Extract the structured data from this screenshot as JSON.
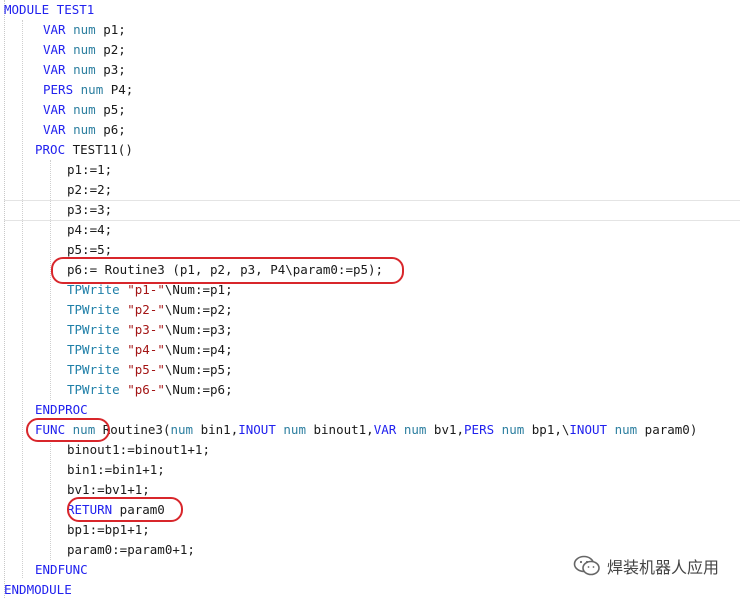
{
  "code": {
    "lines": [
      {
        "indent": 0,
        "tokens": [
          {
            "t": "MODULE TEST1",
            "c": "kw"
          }
        ]
      },
      {
        "indent": 3,
        "tokens": [
          {
            "t": "VAR",
            "c": "kw"
          },
          {
            "t": " "
          },
          {
            "t": "num",
            "c": "ty"
          },
          {
            "t": " p1;"
          }
        ]
      },
      {
        "indent": 3,
        "tokens": [
          {
            "t": "VAR",
            "c": "kw"
          },
          {
            "t": " "
          },
          {
            "t": "num",
            "c": "ty"
          },
          {
            "t": " p2;"
          }
        ]
      },
      {
        "indent": 3,
        "tokens": [
          {
            "t": "VAR",
            "c": "kw"
          },
          {
            "t": " "
          },
          {
            "t": "num",
            "c": "ty"
          },
          {
            "t": " p3;"
          }
        ]
      },
      {
        "indent": 3,
        "tokens": [
          {
            "t": "PERS",
            "c": "kw"
          },
          {
            "t": " "
          },
          {
            "t": "num",
            "c": "ty"
          },
          {
            "t": " P4;"
          }
        ]
      },
      {
        "indent": 3,
        "tokens": [
          {
            "t": "VAR",
            "c": "kw"
          },
          {
            "t": " "
          },
          {
            "t": "num",
            "c": "ty"
          },
          {
            "t": " p5;"
          }
        ]
      },
      {
        "indent": 3,
        "tokens": [
          {
            "t": "VAR",
            "c": "kw"
          },
          {
            "t": " "
          },
          {
            "t": "num",
            "c": "ty"
          },
          {
            "t": " p6;"
          }
        ]
      },
      {
        "indent": 2,
        "tokens": [
          {
            "t": "PROC",
            "c": "kw"
          },
          {
            "t": " TEST11()"
          }
        ]
      },
      {
        "indent": 4,
        "tokens": [
          {
            "t": "p1:=1;"
          }
        ]
      },
      {
        "indent": 4,
        "tokens": [
          {
            "t": "p2:=2;"
          }
        ]
      },
      {
        "indent": 4,
        "tokens": [
          {
            "t": "p3:=3;"
          }
        ]
      },
      {
        "indent": 4,
        "tokens": [
          {
            "t": "p4:=4;"
          }
        ]
      },
      {
        "indent": 4,
        "tokens": [
          {
            "t": "p5:=5;"
          }
        ]
      },
      {
        "indent": 4,
        "tokens": [
          {
            "t": "p6:= Routine3 (p1, p2, p3, P4\\param0:=p5);"
          }
        ]
      },
      {
        "indent": 4,
        "tokens": [
          {
            "t": "TPWrite",
            "c": "fn"
          },
          {
            "t": " "
          },
          {
            "t": "\"p1-\"",
            "c": "str"
          },
          {
            "t": "\\Num:=p1;"
          }
        ]
      },
      {
        "indent": 4,
        "tokens": [
          {
            "t": "TPWrite",
            "c": "fn"
          },
          {
            "t": " "
          },
          {
            "t": "\"p2-\"",
            "c": "str"
          },
          {
            "t": "\\Num:=p2;"
          }
        ]
      },
      {
        "indent": 4,
        "tokens": [
          {
            "t": "TPWrite",
            "c": "fn"
          },
          {
            "t": " "
          },
          {
            "t": "\"p3-\"",
            "c": "str"
          },
          {
            "t": "\\Num:=p3;"
          }
        ]
      },
      {
        "indent": 4,
        "tokens": [
          {
            "t": "TPWrite",
            "c": "fn"
          },
          {
            "t": " "
          },
          {
            "t": "\"p4-\"",
            "c": "str"
          },
          {
            "t": "\\Num:=p4;"
          }
        ]
      },
      {
        "indent": 4,
        "tokens": [
          {
            "t": "TPWrite",
            "c": "fn"
          },
          {
            "t": " "
          },
          {
            "t": "\"p5-\"",
            "c": "str"
          },
          {
            "t": "\\Num:=p5;"
          }
        ]
      },
      {
        "indent": 4,
        "tokens": [
          {
            "t": "TPWrite",
            "c": "fn"
          },
          {
            "t": " "
          },
          {
            "t": "\"p6-\"",
            "c": "str"
          },
          {
            "t": "\\Num:=p6;"
          }
        ]
      },
      {
        "indent": 2,
        "tokens": [
          {
            "t": "ENDPROC",
            "c": "kw"
          }
        ]
      },
      {
        "indent": 2,
        "tokens": [
          {
            "t": "FUNC",
            "c": "kw"
          },
          {
            "t": " "
          },
          {
            "t": "num",
            "c": "ty"
          },
          {
            "t": " Routine3("
          },
          {
            "t": "num",
            "c": "ty"
          },
          {
            "t": " bin1,"
          },
          {
            "t": "INOUT",
            "c": "kw"
          },
          {
            "t": " "
          },
          {
            "t": "num",
            "c": "ty"
          },
          {
            "t": " binout1,"
          },
          {
            "t": "VAR",
            "c": "kw"
          },
          {
            "t": " "
          },
          {
            "t": "num",
            "c": "ty"
          },
          {
            "t": " bv1,"
          },
          {
            "t": "PERS",
            "c": "kw"
          },
          {
            "t": " "
          },
          {
            "t": "num",
            "c": "ty"
          },
          {
            "t": " bp1,\\"
          },
          {
            "t": "INOUT",
            "c": "kw"
          },
          {
            "t": " "
          },
          {
            "t": "num",
            "c": "ty"
          },
          {
            "t": " param0)"
          }
        ]
      },
      {
        "indent": 4,
        "tokens": [
          {
            "t": "binout1:=binout1+1;"
          }
        ]
      },
      {
        "indent": 4,
        "tokens": [
          {
            "t": "bin1:=bin1+1;"
          }
        ]
      },
      {
        "indent": 4,
        "tokens": [
          {
            "t": "bv1:=bv1+1;"
          }
        ]
      },
      {
        "indent": 4,
        "tokens": [
          {
            "t": "RETURN",
            "c": "kw"
          },
          {
            "t": " param0"
          }
        ]
      },
      {
        "indent": 4,
        "tokens": [
          {
            "t": "bp1:=bp1+1;"
          }
        ]
      },
      {
        "indent": 4,
        "tokens": [
          {
            "t": "param0:=param0+1;"
          }
        ]
      },
      {
        "indent": 2,
        "tokens": [
          {
            "t": "ENDFUNC",
            "c": "kw"
          }
        ]
      },
      {
        "indent": 0,
        "tokens": [
          {
            "t": "ENDMODULE",
            "c": "kw"
          }
        ]
      }
    ]
  },
  "watermark": {
    "text": "焊装机器人应用",
    "icon": "wechat-icon"
  },
  "colors": {
    "keyword": "#2222ee",
    "type": "#2d7fa0",
    "string": "#a31515",
    "highlight_oval": "#d8262b"
  }
}
